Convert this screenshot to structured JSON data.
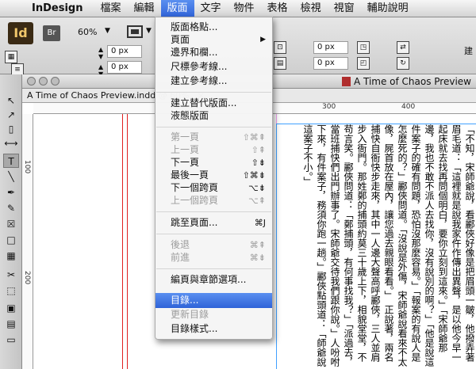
{
  "menubar": {
    "app_name": "InDesign",
    "items": [
      "檔案",
      "編輯",
      "版面",
      "文字",
      "物件",
      "表格",
      "檢視",
      "視窗",
      "輔助說明"
    ],
    "active_index": 2
  },
  "control": {
    "app_icon": "Id",
    "bridge": "Br",
    "zoom": "60%",
    "x_field": "0 px",
    "y_field": "0 px",
    "w_field": "0 px",
    "h_field": "0 px",
    "right_label": "建"
  },
  "document": {
    "window_title": "A Time of Chaos Preview",
    "tab_label": "A Time of Chaos Preview.indd @ 60%",
    "tab_close": "×",
    "hruler_ticks": [
      "300",
      "400"
    ],
    "vruler_ticks": [
      "100",
      "200"
    ],
    "body_text": "「不知，宋師爺說，看酈俠好像是把眉頭一皺，他撥弄著眉毛道：「這裡就是說我家仵作傳出異聲，是以他今早一起床就去找再問個明白，要你立刻到這來。」「宋師爺那邊，我也不敢不派人去找你，沒有說別的啊？」「他是說這件案子的確有問題，恐怕沒那麼容易。」「報案的有說人是怎麼死的？」酈俠問道。「沒說是外傷，宋師爺說看來不太像，屍首放在屋內，讓您過去親眼看看。」　正說著，兩名捕快自衙快步走來，其中一人邊大聲高呼酈俠，三人並肩步入衙門。那姓鄭的捕頭約莫三十歲上下，相貌堂堂，不苟言笑。酈俠問道：「鄭捕頭，有何事找我？」「派過去，當班捕快們出門辦事了。宋師爺交待我們跟你說。」人吩咐下來，有件案子，務須你跑一趟。」酈俠點頭道：「師爺說這案子不小。」"
  },
  "tools": [
    "selection-tool",
    "direct-select-tool",
    "page-tool",
    "gap-tool",
    "type-tool",
    "line-tool",
    "pen-tool",
    "pencil-tool",
    "rect-frame-tool",
    "rect-tool",
    "table-tool",
    "scissors-tool",
    "free-transform-tool",
    "gradient-tool",
    "gradient-feather-tool",
    "note-tool"
  ],
  "layout_menu": {
    "items": [
      {
        "label": "版面格點...",
        "shortcut": "",
        "submenu": false,
        "disabled": false,
        "highlighted": false
      },
      {
        "label": "頁面",
        "shortcut": "",
        "submenu": true,
        "disabled": false,
        "highlighted": false
      },
      {
        "label": "邊界和欄...",
        "shortcut": "",
        "submenu": false,
        "disabled": false,
        "highlighted": false
      },
      {
        "label": "尺標參考線...",
        "shortcut": "",
        "submenu": false,
        "disabled": false,
        "highlighted": false
      },
      {
        "label": "建立參考線...",
        "shortcut": "",
        "submenu": false,
        "disabled": false,
        "highlighted": false
      },
      {
        "label": "建立替代版面...",
        "shortcut": "",
        "submenu": false,
        "disabled": false,
        "highlighted": false
      },
      {
        "label": "液態版面",
        "shortcut": "",
        "submenu": false,
        "disabled": false,
        "highlighted": false
      },
      {
        "label": "第一頁",
        "shortcut": "⇧⌘⇞",
        "submenu": false,
        "disabled": true,
        "highlighted": false
      },
      {
        "label": "上一頁",
        "shortcut": "⇧⇞",
        "submenu": false,
        "disabled": true,
        "highlighted": false
      },
      {
        "label": "下一頁",
        "shortcut": "⇧⇟",
        "submenu": false,
        "disabled": false,
        "highlighted": false
      },
      {
        "label": "最後一頁",
        "shortcut": "⇧⌘⇟",
        "submenu": false,
        "disabled": false,
        "highlighted": false
      },
      {
        "label": "下一個跨頁",
        "shortcut": "⌥⇟",
        "submenu": false,
        "disabled": false,
        "highlighted": false
      },
      {
        "label": "上一個跨頁",
        "shortcut": "⌥⇞",
        "submenu": false,
        "disabled": true,
        "highlighted": false
      },
      {
        "label": "跳至頁面...",
        "shortcut": "⌘J",
        "submenu": false,
        "disabled": false,
        "highlighted": false
      },
      {
        "label": "後退",
        "shortcut": "⌘⇞",
        "submenu": false,
        "disabled": true,
        "highlighted": false
      },
      {
        "label": "前進",
        "shortcut": "⌘⇟",
        "submenu": false,
        "disabled": true,
        "highlighted": false
      },
      {
        "label": "編頁與章節選項...",
        "shortcut": "",
        "submenu": false,
        "disabled": false,
        "highlighted": false
      },
      {
        "label": "目錄...",
        "shortcut": "",
        "submenu": false,
        "disabled": false,
        "highlighted": true
      },
      {
        "label": "更新目錄",
        "shortcut": "",
        "submenu": false,
        "disabled": true,
        "highlighted": false
      },
      {
        "label": "目錄樣式...",
        "shortcut": "",
        "submenu": false,
        "disabled": false,
        "highlighted": false
      }
    ]
  }
}
